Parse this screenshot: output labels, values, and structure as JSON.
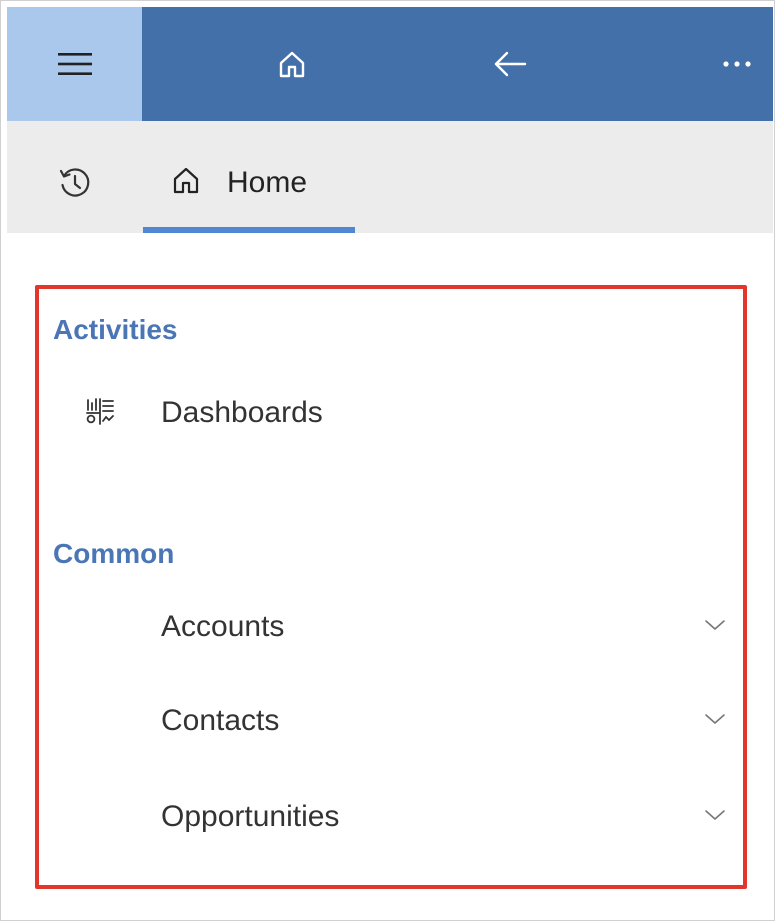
{
  "topbar": {
    "menu_icon": "hamburger-icon",
    "home_icon": "home-icon",
    "back_icon": "arrow-left-icon",
    "more_icon": "ellipsis-icon",
    "colors": {
      "bar": "#4470aa",
      "menu_cell": "#aac8ec"
    }
  },
  "tabs": {
    "history_icon": "history-icon",
    "home_tab": {
      "icon": "home-outline-icon",
      "label": "Home"
    },
    "accent": "#4f87d0"
  },
  "nav": {
    "highlight_color": "#e2362d",
    "sections": [
      {
        "title": "Activities",
        "items": [
          {
            "label": "Dashboards",
            "icon": "dashboard-icon",
            "expandable": false
          }
        ]
      },
      {
        "title": "Common",
        "items": [
          {
            "label": "Accounts",
            "expandable": true
          },
          {
            "label": "Contacts",
            "expandable": true
          },
          {
            "label": "Opportunities",
            "expandable": true
          }
        ]
      }
    ],
    "section_color": "#4a76b6"
  }
}
